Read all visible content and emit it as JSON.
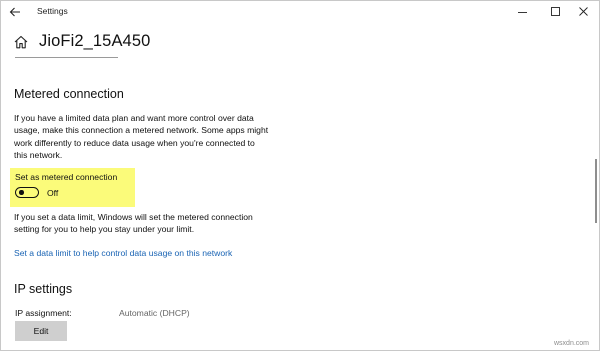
{
  "window": {
    "title": "Settings",
    "icons": [
      "back-arrow-icon",
      "minimize-icon",
      "maximize-icon",
      "close-icon",
      "home-icon"
    ]
  },
  "header": {
    "title": "JioFi2_15A450"
  },
  "metered": {
    "heading": "Metered connection",
    "description_lines": [
      "If you have a limited data plan and want more control over data",
      "usage, make this connection a metered network. Some apps might",
      "work differently to reduce data usage when you're connected to",
      "this network."
    ],
    "toggle_label": "Set as metered connection",
    "toggle_state": "Off",
    "toggle_on": false,
    "data_limit_lines": [
      "If you set a data limit, Windows will set the metered connection",
      "setting for you to help you stay under your limit."
    ],
    "link_text": "Set a data limit to help control data usage on this network"
  },
  "ip": {
    "heading": "IP settings",
    "assignment_label": "IP assignment:",
    "assignment_value": "Automatic (DHCP)",
    "edit_label": "Edit"
  },
  "watermark": "wsxdn.com",
  "colors": {
    "highlight": "#fbfb7a",
    "link": "#1a64b4",
    "button": "#cfcfcf"
  }
}
